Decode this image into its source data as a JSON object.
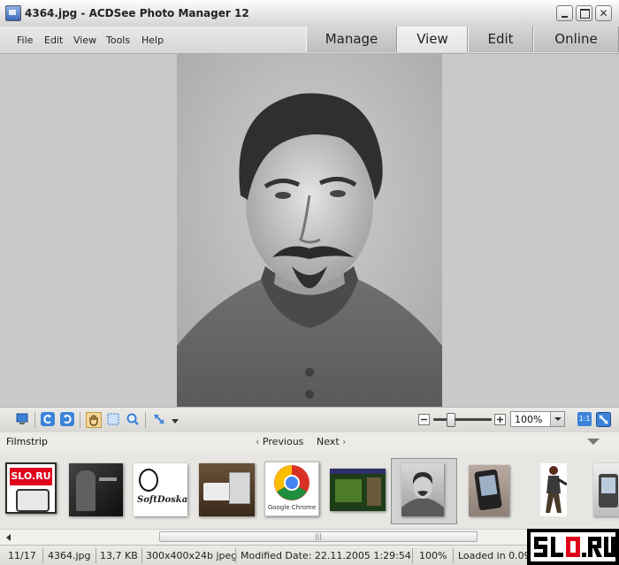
{
  "window": {
    "title": "4364.jpg - ACDSee Photo Manager 12"
  },
  "menu": [
    "File",
    "Edit",
    "View",
    "Tools",
    "Help"
  ],
  "mode_tabs": [
    "Manage",
    "View",
    "Edit",
    "Online"
  ],
  "active_mode": "View",
  "zoom": {
    "value": "100%",
    "fit_label": "1:1"
  },
  "filmstrip": {
    "label": "Filmstrip",
    "previous": "Previous",
    "next": "Next",
    "thumbnails": [
      {
        "label": "SLO.RU",
        "selected": false
      },
      {
        "label": "",
        "selected": false
      },
      {
        "label": "SoftDoska",
        "selected": false
      },
      {
        "label": "",
        "selected": false
      },
      {
        "label": "Google Chrome",
        "selected": false
      },
      {
        "label": "",
        "selected": false
      },
      {
        "label": "",
        "selected": true
      },
      {
        "label": "",
        "selected": false
      },
      {
        "label": "",
        "selected": false
      },
      {
        "label": "",
        "selected": false
      }
    ]
  },
  "status": {
    "position": "11/17",
    "filename": "4364.jpg",
    "size": "13,7 KB",
    "dimensions": "300x400x24b jpeg",
    "modified": "Modified Date: 22.11.2005 1:29:54",
    "zoom": "100%",
    "loaded": "Loaded in 0.09 s"
  },
  "logo": "SLO.RU",
  "colors": {
    "accent": "#3c83d8",
    "logo_red": "#e0001b",
    "viewer_bg": "#c9c9c9"
  }
}
